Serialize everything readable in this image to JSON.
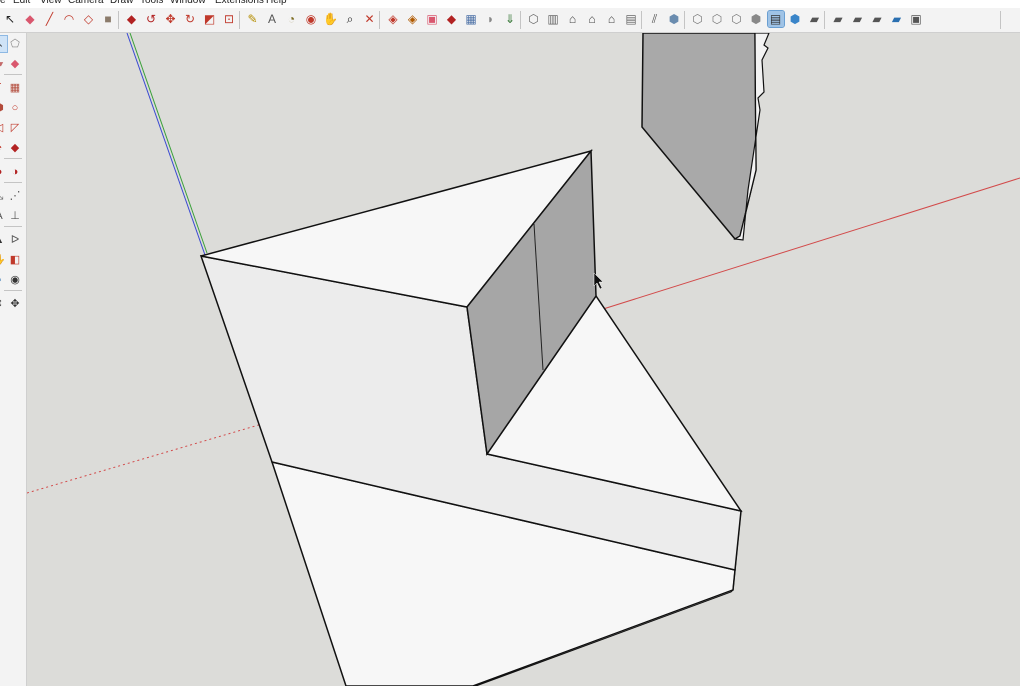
{
  "menu": [
    "e",
    "Edit",
    "View",
    "Camera",
    "Draw",
    "Tools",
    "Window",
    "Extensions",
    "Help"
  ],
  "toolbar_icons": [
    {
      "name": "select-icon",
      "glyph": "↖",
      "color": "#222222"
    },
    {
      "name": "eraser-icon",
      "glyph": "◆",
      "color": "#d9576e"
    },
    {
      "name": "pencil-icon",
      "glyph": "╱",
      "color": "#c0392b"
    },
    {
      "name": "arc-icon",
      "glyph": "◠",
      "color": "#c0392b"
    },
    {
      "name": "shape-icon",
      "glyph": "◇",
      "color": "#c0392b"
    },
    {
      "name": "paint-bucket-icon",
      "glyph": "■",
      "color": "#8b7b6b"
    },
    {
      "name": "push-pull-icon",
      "glyph": "◆",
      "color": "#b22222"
    },
    {
      "name": "follow-me-icon",
      "glyph": "↺",
      "color": "#b22222"
    },
    {
      "name": "move-icon",
      "glyph": "✥",
      "color": "#c0392b"
    },
    {
      "name": "rotate-icon",
      "glyph": "↻",
      "color": "#c0392b"
    },
    {
      "name": "scale-icon",
      "glyph": "◩",
      "color": "#c0392b"
    },
    {
      "name": "offset-icon",
      "glyph": "⊡",
      "color": "#c0392b"
    },
    {
      "name": "tape-measure-icon",
      "glyph": "✎",
      "color": "#b58d00"
    },
    {
      "name": "text-icon",
      "glyph": "A",
      "color": "#555555"
    },
    {
      "name": "protractor-icon",
      "glyph": "◔",
      "color": "#7b6b20"
    },
    {
      "name": "orbit-icon",
      "glyph": "◉",
      "color": "#c0392b"
    },
    {
      "name": "hand-pan-icon",
      "glyph": "✋",
      "color": "#b58d00"
    },
    {
      "name": "zoom-icon",
      "glyph": "⌕",
      "color": "#222222"
    },
    {
      "name": "zoom-extents-icon",
      "glyph": "✕",
      "color": "#c0392b"
    },
    {
      "name": "warehouse-icon",
      "glyph": "◈",
      "color": "#c0392b"
    },
    {
      "name": "extension-warehouse-icon",
      "glyph": "◈",
      "color": "#b05a00"
    },
    {
      "name": "layout-icon",
      "glyph": "▣",
      "color": "#d9576e"
    },
    {
      "name": "style-builder-icon",
      "glyph": "◆",
      "color": "#b22222"
    },
    {
      "name": "section-plane-icon",
      "glyph": "▦",
      "color": "#4a6fa5"
    },
    {
      "name": "section-fill-icon",
      "glyph": "◗",
      "color": "#888888"
    },
    {
      "name": "import-icon",
      "glyph": "⇓",
      "color": "#3a7a3a"
    },
    {
      "name": "iso-view-icon",
      "glyph": "⬡",
      "color": "#666666"
    },
    {
      "name": "top-view-icon",
      "glyph": "▥",
      "color": "#666666"
    },
    {
      "name": "front-view-icon",
      "glyph": "⌂",
      "color": "#444444"
    },
    {
      "name": "right-view-icon",
      "glyph": "⌂",
      "color": "#444444"
    },
    {
      "name": "back-view-icon",
      "glyph": "⌂",
      "color": "#444444"
    },
    {
      "name": "left-view-icon",
      "glyph": "▤",
      "color": "#666666"
    },
    {
      "name": "perspective-icon",
      "glyph": "⫽",
      "color": "#555555"
    },
    {
      "name": "xray-style-icon",
      "glyph": "⬢",
      "color": "#6a8caf"
    },
    {
      "name": "back-edges-style-icon",
      "glyph": "⬡",
      "color": "#777777"
    },
    {
      "name": "wireframe-style-icon",
      "glyph": "⬡",
      "color": "#777777"
    },
    {
      "name": "hidden-line-style-icon",
      "glyph": "⬡",
      "color": "#777777"
    },
    {
      "name": "shaded-style-icon",
      "glyph": "⬢",
      "color": "#888888"
    },
    {
      "name": "shaded-textures-style-icon",
      "glyph": "▤",
      "color": "#333333",
      "active": true
    },
    {
      "name": "monochrome-style-icon",
      "glyph": "⬢",
      "color": "#3a85c9"
    },
    {
      "name": "component-icon",
      "glyph": "▰",
      "color": "#555555"
    },
    {
      "name": "solid-union-icon",
      "glyph": "▰",
      "color": "#555555"
    },
    {
      "name": "solid-intersect-icon",
      "glyph": "▰",
      "color": "#555555"
    },
    {
      "name": "solid-subtract-icon",
      "glyph": "▰",
      "color": "#555555"
    },
    {
      "name": "solid-trim-icon",
      "glyph": "▰",
      "color": "#2a6fb0"
    },
    {
      "name": "sandbox-icon",
      "glyph": "▣",
      "color": "#555555"
    }
  ],
  "left_icons": [
    {
      "name": "select-tool-icon",
      "glyph": "↖",
      "color": "#333333",
      "active": true
    },
    {
      "name": "make-component-icon",
      "glyph": "⬠",
      "color": "#888888"
    },
    {
      "name": "paint-tool-icon",
      "glyph": "▰",
      "color": "#c46a6a"
    },
    {
      "name": "eraser-tool-icon",
      "glyph": "◆",
      "color": "#d9576e"
    },
    {
      "name": "freehand-tool-icon",
      "glyph": "ʃ",
      "color": "#c0392b"
    },
    {
      "name": "rectangle-tool-icon",
      "glyph": "▦",
      "color": "#b24a3a"
    },
    {
      "name": "rotated-rect-tool-icon",
      "glyph": "⬢",
      "color": "#b24a3a"
    },
    {
      "name": "circle-tool-icon",
      "glyph": "○",
      "color": "#c0392b"
    },
    {
      "name": "polygon-tool-icon",
      "glyph": "◁",
      "color": "#c0392b"
    },
    {
      "name": "arc-tool-icon",
      "glyph": "◸",
      "color": "#c0392b"
    },
    {
      "name": "pie-tool-icon",
      "glyph": "◔",
      "color": "#c0392b"
    },
    {
      "name": "push-pull-tool-icon",
      "glyph": "◆",
      "color": "#b22222"
    },
    {
      "name": "follow-me-tool-icon",
      "glyph": "◕",
      "color": "#b22222"
    },
    {
      "name": "offset-tool-icon",
      "glyph": "◑",
      "color": "#b22222"
    },
    {
      "name": "tape-tool-icon",
      "glyph": "⤡",
      "color": "#666666"
    },
    {
      "name": "dimension-tool-icon",
      "glyph": "⋰",
      "color": "#555555"
    },
    {
      "name": "text-tool-icon",
      "glyph": "A",
      "color": "#555555"
    },
    {
      "name": "axes-tool-icon",
      "glyph": "⊥",
      "color": "#555555"
    },
    {
      "name": "3d-text-tool-icon",
      "glyph": "▲",
      "color": "#333333"
    },
    {
      "name": "walk-tool-icon",
      "glyph": "ᐅ",
      "color": "#555555"
    },
    {
      "name": "pan-tool-icon",
      "glyph": "✋",
      "color": "#b58d00"
    },
    {
      "name": "zoom-window-tool-icon",
      "glyph": "◧",
      "color": "#c0392b"
    },
    {
      "name": "zoom-tool-icon",
      "glyph": "⌕",
      "color": "#2a6fb0"
    },
    {
      "name": "orbit-tool-icon",
      "glyph": "◉",
      "color": "#333333"
    },
    {
      "name": "look-around-tool-icon",
      "glyph": "⇕",
      "color": "#333333"
    },
    {
      "name": "walk-around-icon",
      "glyph": "✥",
      "color": "#333333"
    }
  ],
  "axes": {
    "red": "#d24a4a",
    "green": "#3aa03a",
    "blue": "#3a4ad2"
  },
  "colors": {
    "sky": "#dcdcd9",
    "face_light": "#f7f7f7",
    "face_mid": "#ededed",
    "face_dark": "#a8a8a8",
    "edge": "#111111"
  }
}
